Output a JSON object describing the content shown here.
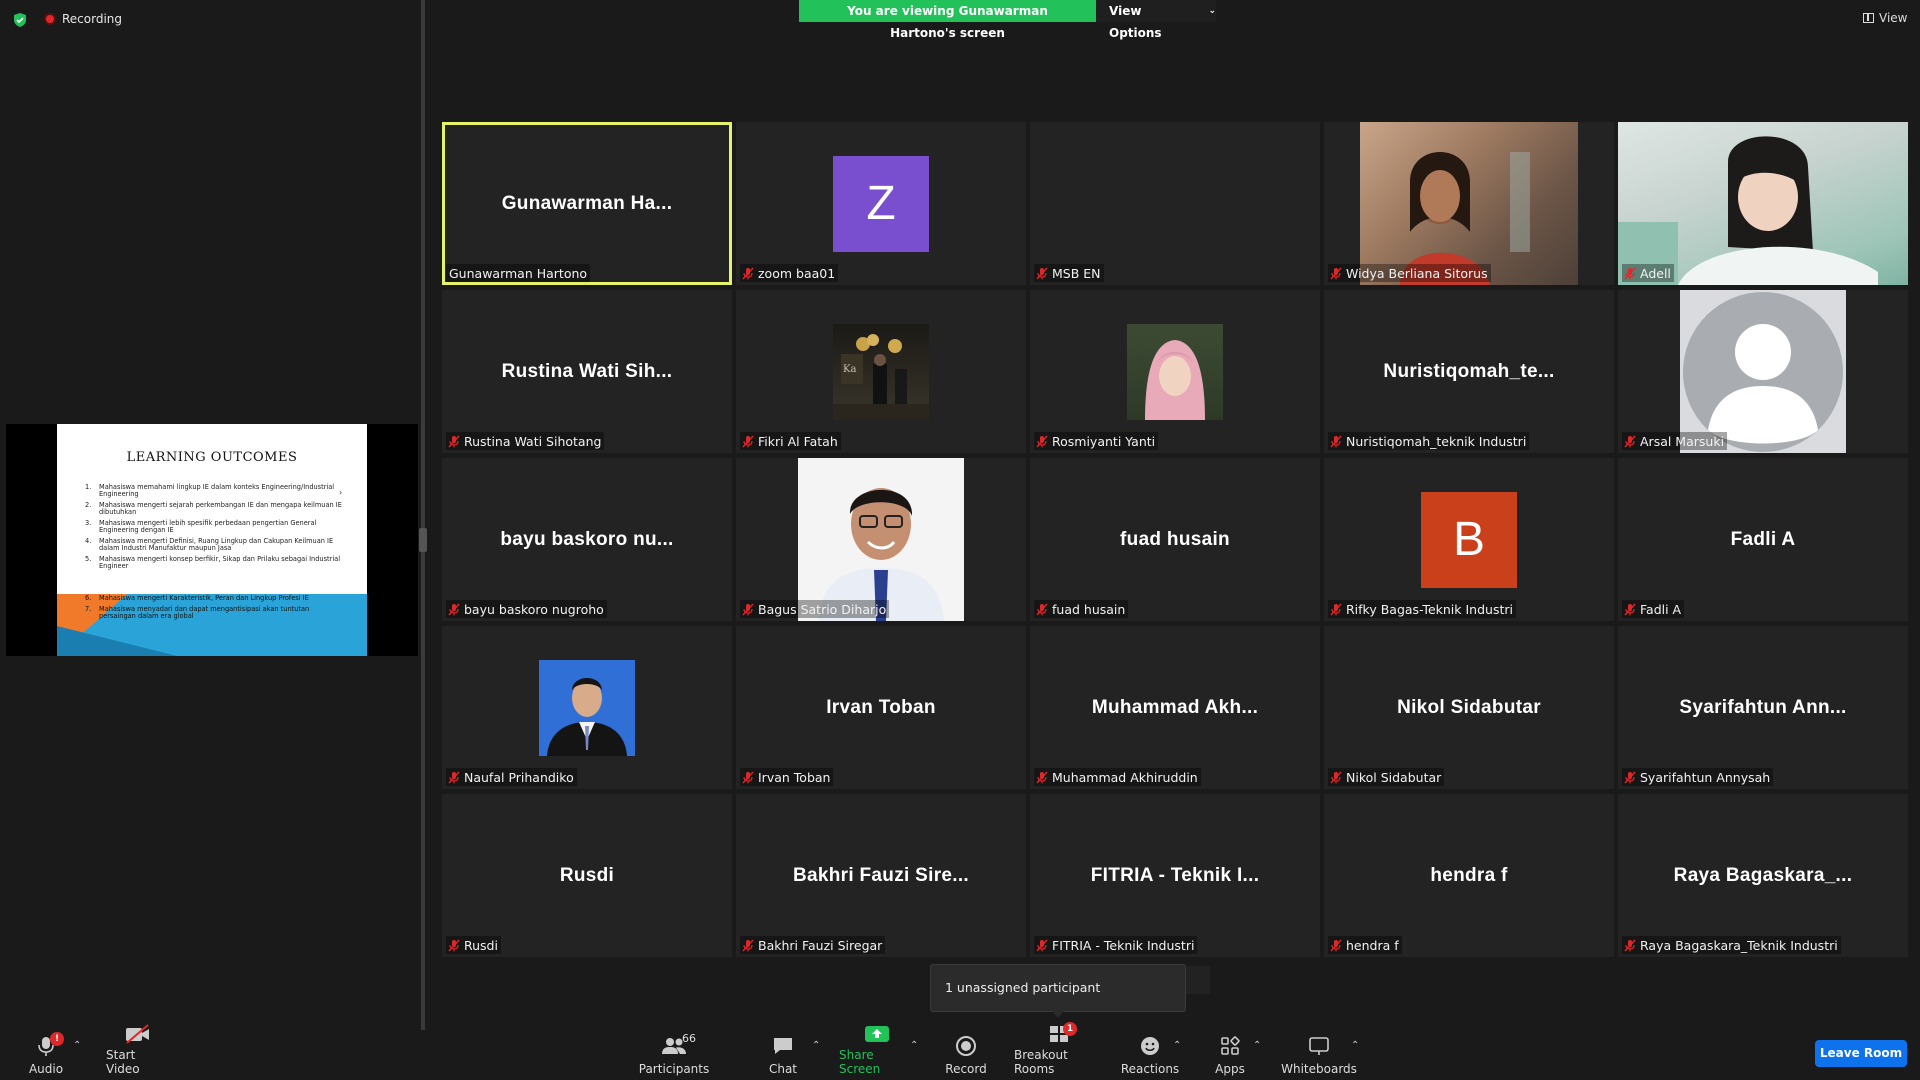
{
  "top": {
    "recording_label": "Recording",
    "banner_text": "You are viewing Gunawarman Hartono's screen",
    "view_options_label": "View Options",
    "view_label": "View"
  },
  "shared_slide": {
    "title": "LEARNING OUTCOMES",
    "items": [
      {
        "n": "1.",
        "text": "Mahasiswa memahami lingkup IE dalam konteks Engineering/Industrial Engineering"
      },
      {
        "n": "2.",
        "text": "Mahasiswa mengerti sejarah perkembangan IE dan mengapa keilmuan IE dibutuhkan"
      },
      {
        "n": "3.",
        "text": "Mahasiswa mengerti lebih spesifik perbedaan pengertian General Engineering dengan IE"
      },
      {
        "n": "4.",
        "text": "Mahasiswa mengerti Definisi, Ruang Lingkup dan Cakupan Keilmuan IE dalam Industri Manufaktur maupun Jasa"
      },
      {
        "n": "5.",
        "text": "Mahasiswa mengerti konsep berfikir, Sikap dan Prilaku sebagai Industrial Engineer"
      },
      {
        "n": "6.",
        "text": "Mahasiswa mengerti Karakteristik, Peran dan Lingkup Profesi IE"
      },
      {
        "n": "7.",
        "text": "Mahasiswa menyadari dan dapat mengantisipasi akan tuntutan persaingan dalam era global"
      }
    ]
  },
  "participants": [
    {
      "big": "Gunawarman  Ha...",
      "label": "Gunawarman Hartono",
      "muted": false,
      "active": true,
      "kind": "name"
    },
    {
      "big": "",
      "label": "zoom baa01",
      "muted": true,
      "kind": "letter",
      "letter": "Z",
      "color": "#7a4fcf"
    },
    {
      "big": "",
      "label": "MSB EN",
      "muted": true,
      "kind": "empty"
    },
    {
      "big": "",
      "label": "Widya Berliana Sitorus",
      "muted": true,
      "kind": "photo-wide",
      "photo": "woman-video"
    },
    {
      "big": "",
      "label": "Adell",
      "muted": true,
      "kind": "photo-wide",
      "photo": "girl-video"
    },
    {
      "big": "Rustina  Wati  Sih...",
      "label": "Rustina Wati Sihotang",
      "muted": true,
      "kind": "name"
    },
    {
      "big": "",
      "label": "Fikri Al Fatah",
      "muted": true,
      "kind": "photo-small",
      "photo": "event-photo"
    },
    {
      "big": "",
      "label": "Rosmiyanti Yanti",
      "muted": true,
      "kind": "photo-small",
      "photo": "hijab-photo"
    },
    {
      "big": "Nuristiqomah_te...",
      "label": "Nuristiqomah_teknik Industri",
      "muted": true,
      "kind": "name"
    },
    {
      "big": "",
      "label": "Arsal Marsuki",
      "muted": true,
      "kind": "default-avatar"
    },
    {
      "big": "bayu  baskoro  nu...",
      "label": "bayu baskoro nugroho",
      "muted": true,
      "kind": "name"
    },
    {
      "big": "",
      "label": "Bagus Satrio Diharjo",
      "muted": true,
      "kind": "photo-portrait",
      "photo": "man-portrait"
    },
    {
      "big": "fuad  husain",
      "label": "fuad husain",
      "muted": true,
      "kind": "name"
    },
    {
      "big": "",
      "label": "Rifky Bagas-Teknik Industri",
      "muted": true,
      "kind": "letter",
      "letter": "B",
      "color": "#c9401a"
    },
    {
      "big": "Fadli  A",
      "label": "Fadli A",
      "muted": true,
      "kind": "name"
    },
    {
      "big": "",
      "label": "Naufal Prihandiko",
      "muted": true,
      "kind": "photo-small",
      "photo": "formal-photo"
    },
    {
      "big": "Irvan  Toban",
      "label": "Irvan Toban",
      "muted": true,
      "kind": "name"
    },
    {
      "big": "Muhammad  Akh...",
      "label": "Muhammad Akhiruddin",
      "muted": true,
      "kind": "name"
    },
    {
      "big": "Nikol  Sidabutar",
      "label": "Nikol Sidabutar",
      "muted": true,
      "kind": "name"
    },
    {
      "big": "Syarifahtun  Ann...",
      "label": "Syarifahtun Annysah",
      "muted": true,
      "kind": "name"
    },
    {
      "big": "Rusdi",
      "label": "Rusdi",
      "muted": true,
      "kind": "name"
    },
    {
      "big": "Bakhri  Fauzi  Sire...",
      "label": "Bakhri Fauzi Siregar",
      "muted": true,
      "kind": "name"
    },
    {
      "big": "FITRIA  -  Teknik  I...",
      "label": "FITRIA - Teknik Industri",
      "muted": true,
      "kind": "name"
    },
    {
      "big": "hendra  f",
      "label": "hendra f",
      "muted": true,
      "kind": "name"
    },
    {
      "big": "Raya  Bagaskara_...",
      "label": "Raya Bagaskara_Teknik Industri",
      "muted": true,
      "kind": "name"
    }
  ],
  "tooltip": {
    "text": "1 unassigned participant"
  },
  "toolbar": {
    "audio": "Audio",
    "audio_badge": "!",
    "start_video": "Start Video",
    "participants": "Participants",
    "participants_count": "66",
    "chat": "Chat",
    "share_screen": "Share Screen",
    "record": "Record",
    "breakout_rooms": "Breakout Rooms",
    "breakout_badge": "1",
    "reactions": "Reactions",
    "apps": "Apps",
    "whiteboards": "Whiteboards",
    "leave_room": "Leave Room"
  },
  "colors": {
    "active_speaker": "#e4f36a",
    "share_green": "#23c15a",
    "leave_blue": "#0e72ed",
    "mute_red": "#e02828"
  }
}
